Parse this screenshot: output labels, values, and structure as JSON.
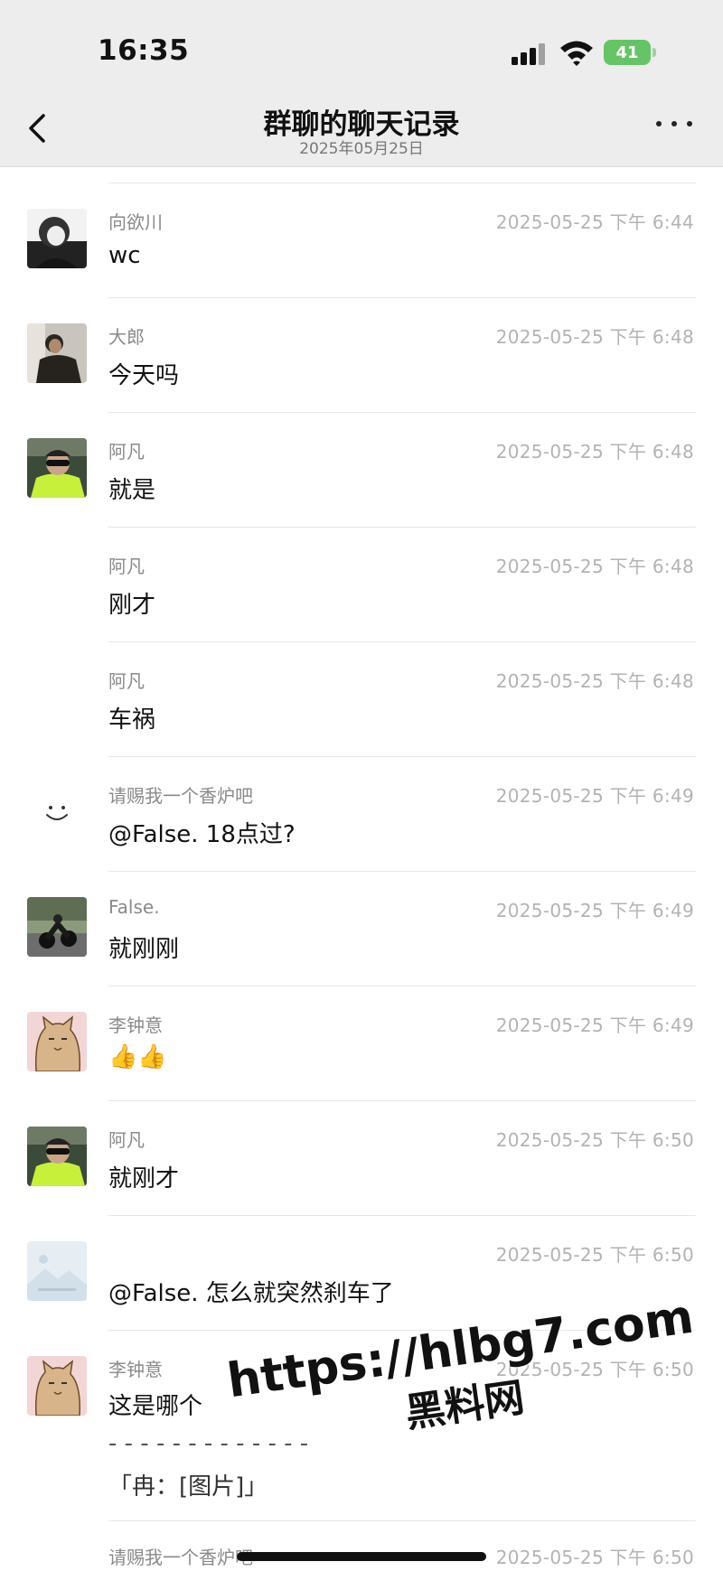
{
  "status_bar": {
    "time": "16:35",
    "battery": "41"
  },
  "nav": {
    "title": "群聊的聊天记录",
    "subtitle": "2025年05月25日"
  },
  "messages": [
    {
      "sender": "向欲川",
      "time": "2025-05-25 下午 6:44",
      "text": "wc",
      "avatar": "avatar-xiangyuchuan"
    },
    {
      "sender": "大郎",
      "time": "2025-05-25 下午 6:48",
      "text": "今天吗",
      "avatar": "avatar-dalang"
    },
    {
      "sender": "阿凡",
      "time": "2025-05-25 下午 6:48",
      "text": "就是",
      "avatar": "avatar-afan"
    },
    {
      "sender": "阿凡",
      "time": "2025-05-25 下午 6:48",
      "text": "刚才",
      "avatar": ""
    },
    {
      "sender": "阿凡",
      "time": "2025-05-25 下午 6:48",
      "text": "车祸",
      "avatar": ""
    },
    {
      "sender": "请赐我一个香炉吧",
      "time": "2025-05-25 下午 6:49",
      "text": "@False. 18点过?",
      "avatar": "avatar-smiley"
    },
    {
      "sender": "False.",
      "time": "2025-05-25 下午 6:49",
      "text": "就刚刚",
      "avatar": "avatar-false"
    },
    {
      "sender": "李钟意",
      "time": "2025-05-25 下午 6:49",
      "text": "👍👍",
      "avatar": "avatar-lizhongyi"
    },
    {
      "sender": "阿凡",
      "time": "2025-05-25 下午 6:50",
      "text": "就刚才",
      "avatar": "avatar-afan"
    },
    {
      "sender": "",
      "time": "2025-05-25 下午 6:50",
      "text": "@False. 怎么就突然刹车了",
      "avatar": "avatar-landscape"
    },
    {
      "sender": "李钟意",
      "time": "2025-05-25 下午 6:50",
      "text": "这是哪个",
      "avatar": "avatar-lizhongyi"
    },
    {
      "sender": "请赐我一个香炉吧",
      "time": "2025-05-25 下午 6:50",
      "text": "",
      "avatar": ""
    }
  ],
  "quote": {
    "line": "- - - - - - - - - - - - -",
    "text": "「冉：[图片]」"
  },
  "watermark": {
    "url": "https://hlbg7.com",
    "name": "黑料网"
  }
}
